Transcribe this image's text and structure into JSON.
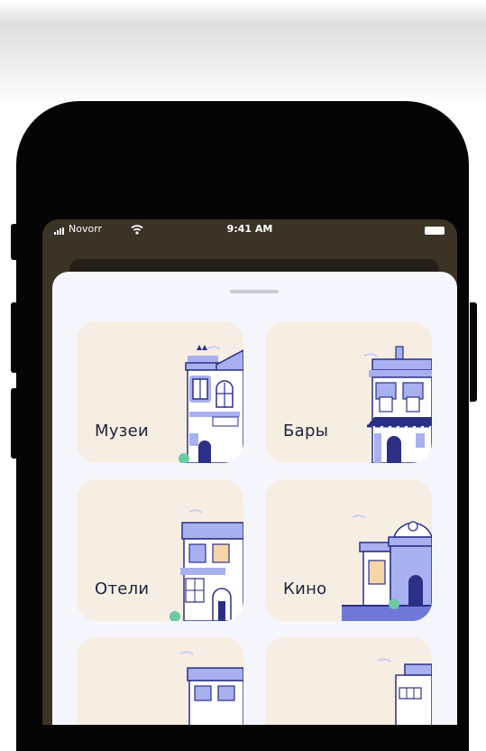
{
  "status_bar": {
    "carrier": "Novorr",
    "time": "9:41 AM"
  },
  "categories": [
    {
      "label": "Музеи",
      "icon": "museum-building-icon"
    },
    {
      "label": "Бары",
      "icon": "bar-building-icon"
    },
    {
      "label": "Отели",
      "icon": "hotel-building-icon"
    },
    {
      "label": "Кино",
      "icon": "cinema-building-icon"
    },
    {
      "label": "",
      "icon": "building-icon"
    },
    {
      "label": "",
      "icon": "building-icon"
    }
  ],
  "colors": {
    "tile_background": "#f6eee2",
    "building_lavender": "#a9b0ef",
    "building_navy": "#2c2f86",
    "sheet_background": "#f4f6fb"
  }
}
